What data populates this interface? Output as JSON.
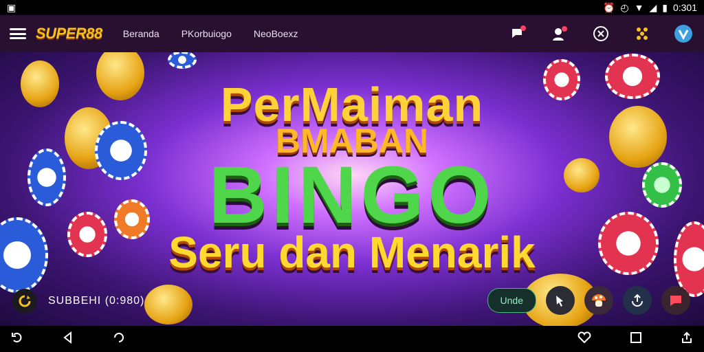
{
  "status_bar": {
    "time": "0:301",
    "icons": [
      "app-notification-icon",
      "alarm-icon",
      "clock-icon",
      "wifi-icon",
      "signal-icon",
      "battery-icon"
    ]
  },
  "app_bar": {
    "logo": "SUPER88",
    "nav": [
      "Beranda",
      "PKorbuiogo",
      "NeoBoexz"
    ],
    "icons": [
      "chat-notification-icon",
      "account-alert-icon",
      "close-circle-icon",
      "apps-grid-icon",
      "avatar-icon"
    ]
  },
  "banner": {
    "line1": "PerMaiman",
    "line2": "BMABAN",
    "line3": "BINGO",
    "line4": "Seru dan Menarik"
  },
  "bottom_overlay": {
    "label": "SUBBEHI (0:980)",
    "pill": "Unde",
    "icons": [
      "sync-icon",
      "hand-icon",
      "mushroom-icon",
      "upload-icon",
      "chat-icon"
    ]
  },
  "colors": {
    "appbar": "#2a1030",
    "accent": "#f7c21c",
    "banner_purple": "#7a2fd0"
  }
}
